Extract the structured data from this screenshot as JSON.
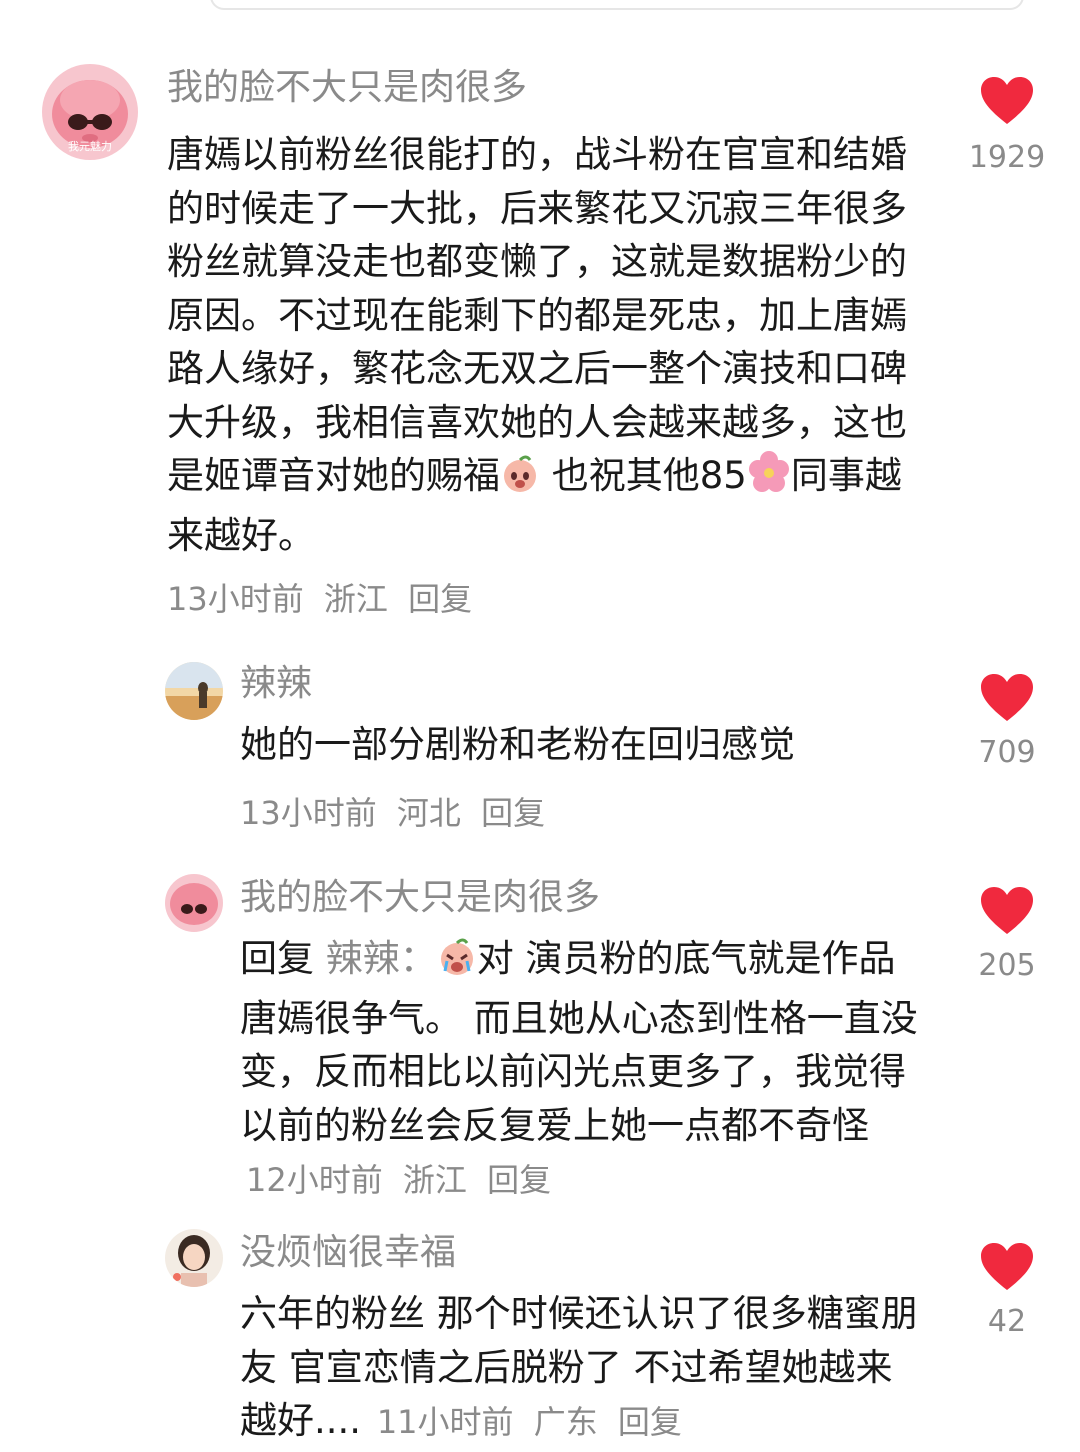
{
  "colors": {
    "like_red": "#f0293e",
    "muted": "#8a8a8a",
    "text": "#1a1a1a"
  },
  "comments": [
    {
      "username": "我的脸不大只是肉很多",
      "text_part1": "唐嫣以前粉丝很能打的，战斗粉在官宣和结婚的时候走了一大批，后来繁花又沉寂三年很多粉丝就算没走也都变懒了，这就是数据粉少的原因。不过现在能剩下的都是死忠，加上唐嫣路人缘好，繁花念无双之后一整个演技和口碑大升级，我相信喜欢她的人会越来越多，这也是姬谭音对她的赐福",
      "text_part2": " 也祝其他85",
      "text_part3": "同事越来越好。",
      "time": "13小时前",
      "location": "浙江",
      "reply_label": "回复",
      "likes": "1929",
      "avatar_icon": "pink-pig-avatar-icon",
      "avatar_text": "我元魅力"
    },
    {
      "username": "辣辣",
      "text": "她的一部分剧粉和老粉在回归感觉",
      "time": "13小时前",
      "location": "河北",
      "reply_label": "回复",
      "likes": "709",
      "avatar_icon": "sunset-person-avatar-icon"
    },
    {
      "username": "我的脸不大只是肉很多",
      "reply_prefix": "回复",
      "reply_to": "辣辣：",
      "text": "对 演员粉的底气就是作品 唐嫣很争气。 而且她从心态到性格一直没变，反而相比以前闪光点更多了，我觉得以前的粉丝会反复爱上她一点都不奇怪",
      "time": "12小时前",
      "location": "浙江",
      "reply_label": "回复",
      "likes": "205",
      "avatar_icon": "pink-pig-avatar-icon"
    },
    {
      "username": "没烦恼很幸福",
      "text": "六年的粉丝 那个时候还认识了很多糖蜜朋友 官宣恋情之后脱粉了 不过希望她越来越好....",
      "time": "11小时前",
      "location": "广东",
      "reply_label": "回复",
      "likes": "42",
      "avatar_icon": "girl-portrait-avatar-icon"
    }
  ]
}
